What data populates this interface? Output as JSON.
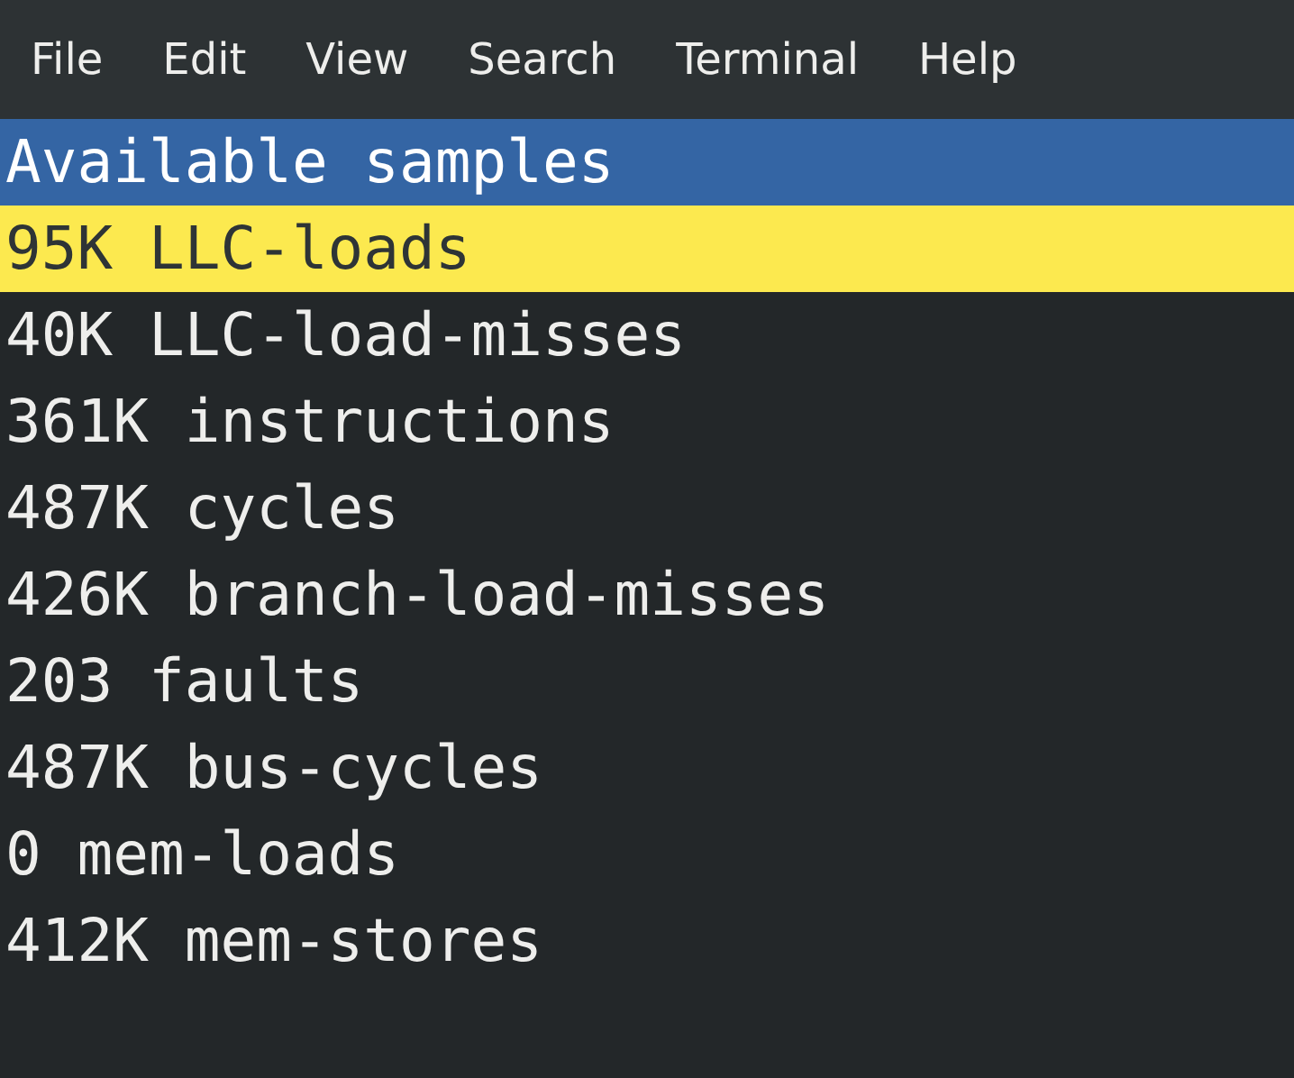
{
  "menu_bar": [
    {
      "label": "File"
    },
    {
      "label": "Edit"
    },
    {
      "label": "View"
    },
    {
      "label": "Search"
    },
    {
      "label": "Terminal"
    },
    {
      "label": "Help"
    }
  ],
  "terminal": {
    "header": "Available samples",
    "rows": [
      {
        "text": "95K LLC-loads",
        "selected": true
      },
      {
        "text": "40K LLC-load-misses",
        "selected": false
      },
      {
        "text": "361K instructions",
        "selected": false
      },
      {
        "text": "487K cycles",
        "selected": false
      },
      {
        "text": "426K branch-load-misses",
        "selected": false
      },
      {
        "text": "203 faults",
        "selected": false
      },
      {
        "text": "487K bus-cycles",
        "selected": false
      },
      {
        "text": "0 mem-loads",
        "selected": false
      },
      {
        "text": "412K mem-stores",
        "selected": false
      }
    ]
  }
}
